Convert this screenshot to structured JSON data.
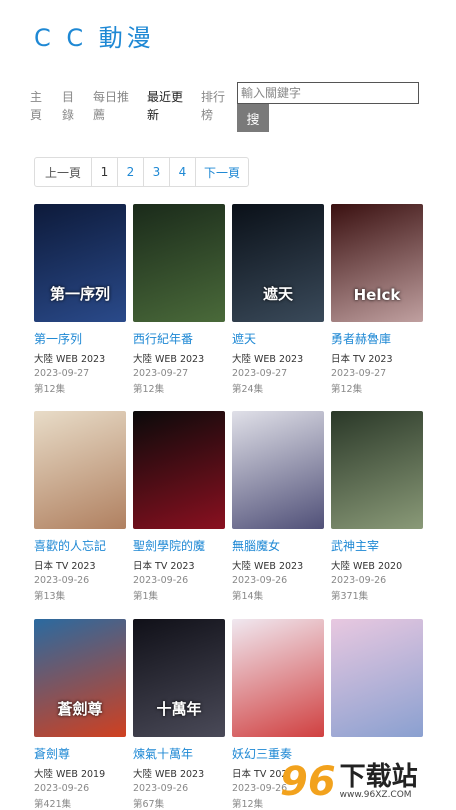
{
  "site": {
    "logo": "C C 動漫"
  },
  "nav": {
    "items": [
      {
        "label": "主頁",
        "active": false
      },
      {
        "label": "目錄",
        "active": false
      },
      {
        "label": "每日推薦",
        "active": false
      },
      {
        "label": "最近更新",
        "active": true
      },
      {
        "label": "排行榜",
        "active": false
      }
    ]
  },
  "search": {
    "placeholder": "輸入關鍵字",
    "button": "搜"
  },
  "pager": {
    "prev": "上一頁",
    "pages": [
      "1",
      "2",
      "3",
      "4"
    ],
    "next": "下一頁"
  },
  "items": [
    {
      "title": "第一序列",
      "meta": "大陸 WEB 2023",
      "date": "2023-09-27",
      "eps": "第12集",
      "colors": [
        "#0d1a3a",
        "#2a4a8a"
      ],
      "poster_text": "第一序列"
    },
    {
      "title": "西行紀年番",
      "meta": "大陸 WEB 2023",
      "date": "2023-09-27",
      "eps": "第12集",
      "colors": [
        "#1a2a1a",
        "#4a6a3a"
      ],
      "poster_text": ""
    },
    {
      "title": "遮天",
      "meta": "大陸 WEB 2023",
      "date": "2023-09-27",
      "eps": "第24集",
      "colors": [
        "#0a1018",
        "#3a4a5a"
      ],
      "poster_text": "遮天"
    },
    {
      "title": "勇者赫魯庫",
      "meta": "日本 TV 2023",
      "date": "2023-09-27",
      "eps": "第12集",
      "colors": [
        "#3a1010",
        "#c0a0a0"
      ],
      "poster_text": "Helck"
    },
    {
      "title": "喜歡的人忘記",
      "meta": "日本 TV 2023",
      "date": "2023-09-26",
      "eps": "第13集",
      "colors": [
        "#e8dcc8",
        "#b08060"
      ],
      "poster_text": ""
    },
    {
      "title": "聖劍學院的魔",
      "meta": "日本 TV 2023",
      "date": "2023-09-26",
      "eps": "第1集",
      "colors": [
        "#0a0a0a",
        "#8a1020"
      ],
      "poster_text": ""
    },
    {
      "title": "無腦魔女",
      "meta": "大陸 WEB 2023",
      "date": "2023-09-26",
      "eps": "第14集",
      "colors": [
        "#e0e0e8",
        "#505078"
      ],
      "poster_text": ""
    },
    {
      "title": "武神主宰",
      "meta": "大陸 WEB 2020",
      "date": "2023-09-26",
      "eps": "第371集",
      "colors": [
        "#2a3828",
        "#8a9a78"
      ],
      "poster_text": ""
    },
    {
      "title": "蒼劍尊",
      "meta": "大陸 WEB 2019",
      "date": "2023-09-26",
      "eps": "第421集",
      "colors": [
        "#2a6aa0",
        "#d04020"
      ],
      "poster_text": "蒼劍尊"
    },
    {
      "title": "煉氣十萬年",
      "meta": "大陸 WEB 2023",
      "date": "2023-09-26",
      "eps": "第67集",
      "colors": [
        "#101018",
        "#4a4a58"
      ],
      "poster_text": "十萬年"
    },
    {
      "title": "妖幻三重奏",
      "meta": "日本 TV 202",
      "date": "2023-09-26",
      "eps": "第12集",
      "colors": [
        "#f0e8f0",
        "#d04040"
      ],
      "poster_text": ""
    },
    {
      "title": "",
      "meta": "",
      "date": "",
      "eps": "",
      "colors": [
        "#e8c8e0",
        "#8aa0d0"
      ],
      "poster_text": ""
    }
  ],
  "watermark": {
    "mark": "96",
    "cn": "下载站",
    "url": "www.96XZ.COM"
  }
}
